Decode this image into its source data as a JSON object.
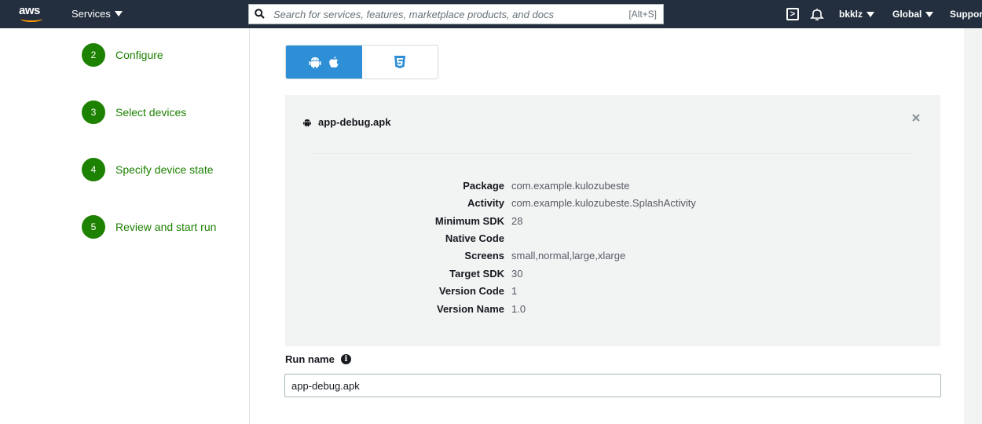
{
  "topbar": {
    "logo_text": "aws",
    "services_label": "Services",
    "search_placeholder": "Search for services, features, marketplace products, and docs",
    "search_shortcut": "[Alt+S]",
    "user_label": "bkklz",
    "region_label": "Global",
    "support_label": "Support",
    "accent": "#ff9900",
    "background": "#232f3e"
  },
  "steps": [
    {
      "number": "2",
      "label": "Configure"
    },
    {
      "number": "3",
      "label": "Select devices"
    },
    {
      "number": "4",
      "label": "Specify device state"
    },
    {
      "number": "5",
      "label": "Review and start run"
    }
  ],
  "step_color": "#1d8102",
  "platform_toggle": {
    "selected": "android-ios",
    "options": [
      "android-ios-icons",
      "html5-icon"
    ],
    "selected_color": "#2f8fd6"
  },
  "app_file": {
    "name": "app-debug.apk",
    "details": [
      {
        "key": "Package",
        "value": "com.example.kulozubeste"
      },
      {
        "key": "Activity",
        "value": "com.example.kulozubeste.SplashActivity"
      },
      {
        "key": "Minimum SDK",
        "value": "28"
      },
      {
        "key": "Native Code",
        "value": ""
      },
      {
        "key": "Screens",
        "value": "small,normal,large,xlarge"
      },
      {
        "key": "Target SDK",
        "value": "30"
      },
      {
        "key": "Version Code",
        "value": "1"
      },
      {
        "key": "Version Name",
        "value": "1.0"
      }
    ]
  },
  "run_name": {
    "label": "Run name",
    "value": "app-debug.apk"
  }
}
